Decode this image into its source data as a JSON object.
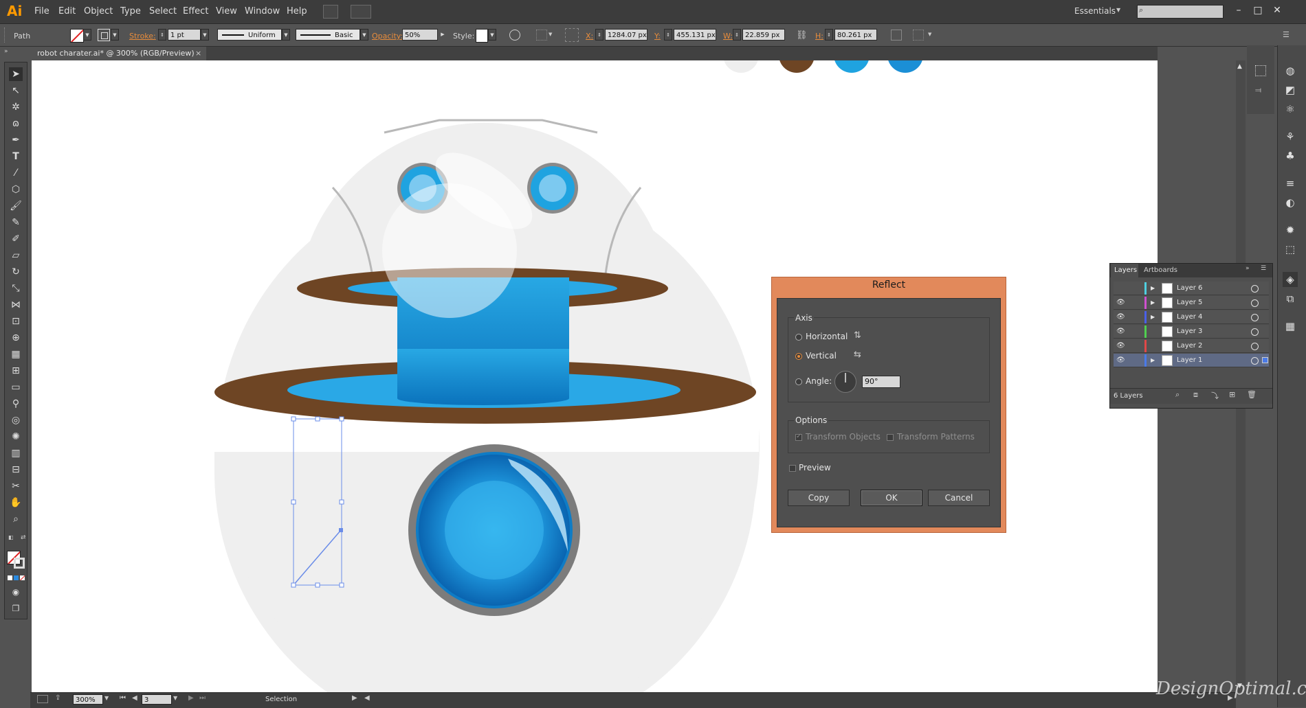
{
  "app": {
    "logo": "Ai"
  },
  "menu": {
    "items": [
      "File",
      "Edit",
      "Object",
      "Type",
      "Select",
      "Effect",
      "View",
      "Window",
      "Help"
    ],
    "workspace": "Essentials",
    "search_placeholder": ""
  },
  "control_bar": {
    "selection_type": "Path",
    "stroke_label": "Stroke:",
    "stroke_weight": "1 pt",
    "profile": "Uniform",
    "brush": "Basic",
    "opacity_label": "Opacity:",
    "opacity": "50%",
    "style_label": "Style:",
    "x_label": "X:",
    "x": "1284.07 px",
    "y_label": "Y:",
    "y": "455.131 px",
    "w_label": "W:",
    "w": "22.859 px",
    "h_label": "H:",
    "h": "80.261 px"
  },
  "document_tab": {
    "title": "robot charater.ai* @ 300% (RGB/Preview)",
    "close": "×"
  },
  "status_bar": {
    "zoom": "300%",
    "artboard": "3",
    "tool": "Selection"
  },
  "layers_panel": {
    "tabs": [
      "Layers",
      "Artboards"
    ],
    "layers": [
      {
        "name": "Layer 6",
        "color": "#4fd0e0",
        "visible": false
      },
      {
        "name": "Layer 5",
        "color": "#d050d0",
        "visible": true
      },
      {
        "name": "Layer 4",
        "color": "#4a60e8",
        "visible": true
      },
      {
        "name": "Layer 3",
        "color": "#50d050",
        "visible": true
      },
      {
        "name": "Layer 2",
        "color": "#e04848",
        "visible": true
      },
      {
        "name": "Layer 1",
        "color": "#4a7ae8",
        "visible": true
      }
    ],
    "count_label": "6 Layers"
  },
  "reflect_dialog": {
    "title": "Reflect",
    "axis_label": "Axis",
    "horizontal_label": "Horizontal",
    "vertical_label": "Vertical",
    "angle_label": "Angle:",
    "angle_value": "90°",
    "options_label": "Options",
    "transform_objects_label": "Transform Objects",
    "transform_patterns_label": "Transform Patterns",
    "preview_label": "Preview",
    "copy_label": "Copy",
    "ok_label": "OK",
    "cancel_label": "Cancel",
    "selected_axis": "vertical"
  },
  "watermark": "DesignOptimal.com",
  "colors": {
    "accent": "#e78c3c",
    "dialog_frame": "#e2895b",
    "robot_blue": "#1fa3e0",
    "robot_brown": "#6e4524",
    "robot_shell": "#ececec"
  }
}
